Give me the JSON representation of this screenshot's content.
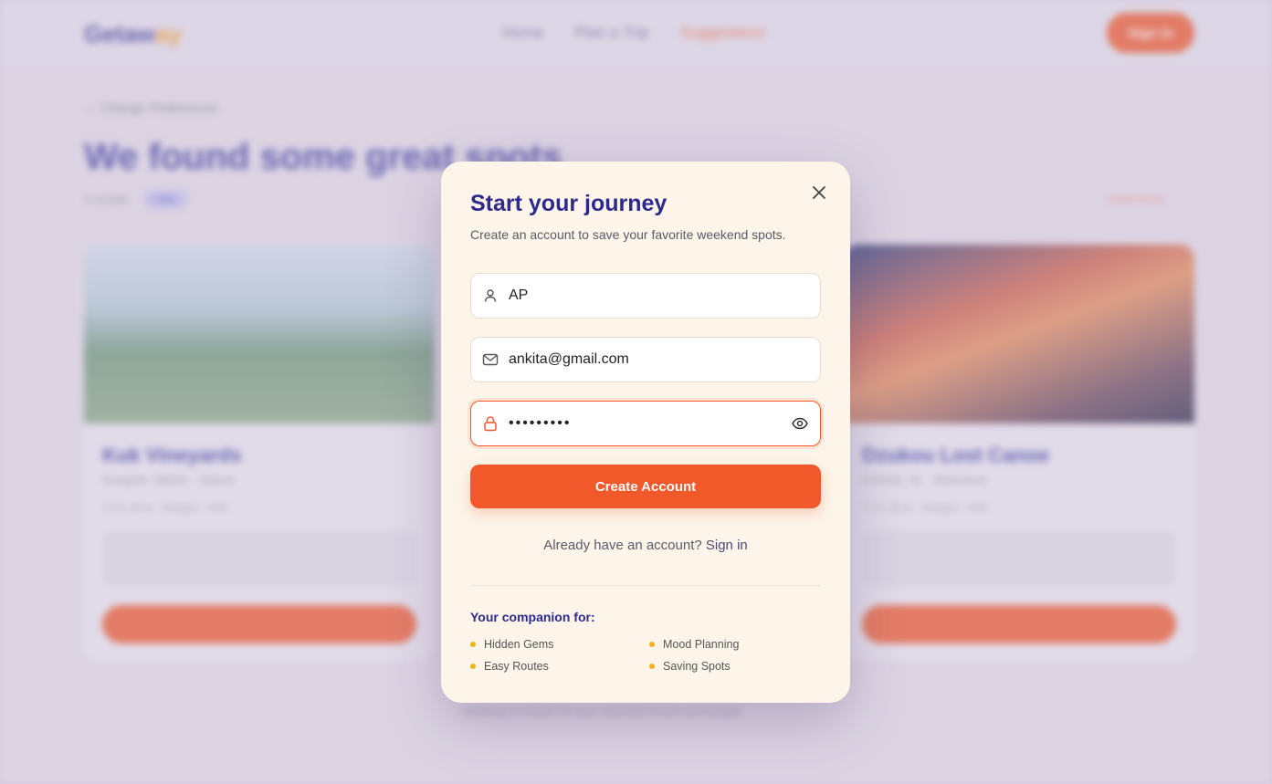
{
  "background": {
    "logo": "Getaw",
    "logo_accent": "ay",
    "nav_links": [
      "Home",
      "Plan a Trip",
      "Suggestions"
    ],
    "nav_signin": "Sign In",
    "back_link": "← Change Preferences",
    "heading": "We found some great spots",
    "results_text": "3 results",
    "results_chip": "Hills",
    "right_link": "Load more",
    "cards": [
      {
        "title": "Kuk Vineyards",
        "location": "Gangtok, Sikkim · Nature",
        "meta": "2 hrs drive · Budget · Hills"
      },
      {
        "title": "Dzukou Lost Canoe",
        "location": "Kohima, NL · Adventure",
        "meta": "3 hrs drive · Budget · Hills"
      }
    ],
    "footer_text": "Showing 3 results for your selected mood and budget"
  },
  "modal": {
    "title": "Start your journey",
    "subtitle": "Create an account to save your favorite weekend spots.",
    "name_value": "AP",
    "email_value": "ankita@gmail.com",
    "password_mask": "•••••••••",
    "create_button": "Create Account",
    "signin_prompt": "Already have an account?",
    "signin_link": "Sign in",
    "companion_title": "Your companion for:",
    "features": [
      "Hidden Gems",
      "Mood Planning",
      "Easy Routes",
      "Saving Spots"
    ],
    "colors": {
      "accent": "#f1592a",
      "title": "#2e2a8c",
      "bullet": "#f2b31a",
      "modal_bg": "#fdf5ea"
    },
    "icons": [
      "user-icon",
      "mail-icon",
      "lock-icon",
      "eye-icon",
      "close-icon"
    ]
  }
}
